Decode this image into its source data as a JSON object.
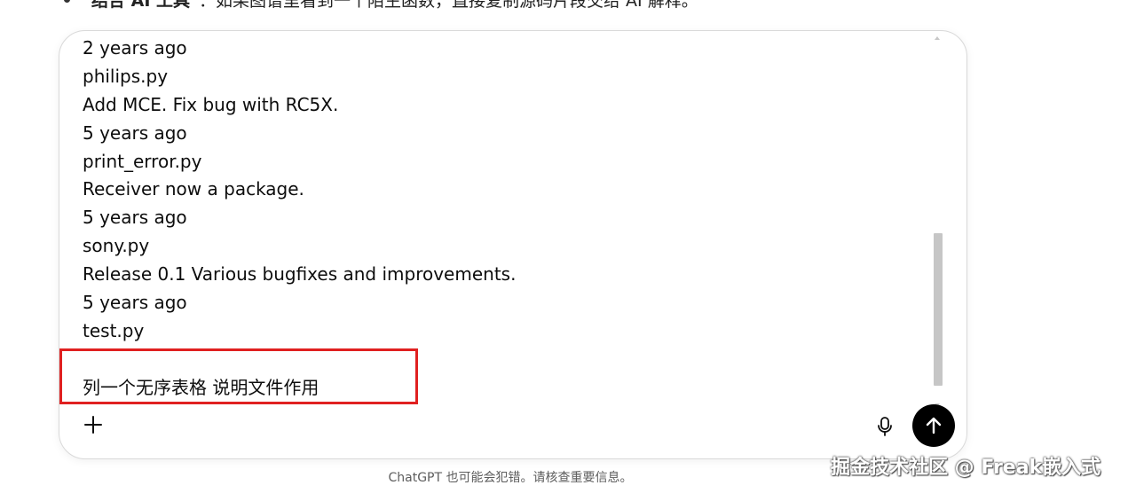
{
  "top_text": {
    "bold_part": "结合 AI 工具",
    "rest": "：如果图谱里看到一个陌生函数，直接复制源码片段交给 AI 解释。"
  },
  "composer": {
    "lines": [
      "2 years ago",
      "philips.py",
      "Add MCE. Fix bug with RC5X.",
      "5 years ago",
      "print_error.py",
      "Receiver now a package.",
      "5 years ago",
      "sony.py",
      "Release 0.1 Various bugfixes and improvements.",
      "5 years ago",
      "test.py",
      "",
      "列一个无序表格 说明文件作用"
    ]
  },
  "icons": {
    "plus": "plus-icon",
    "mic": "microphone-icon",
    "send": "arrow-up-icon"
  },
  "colors": {
    "highlight": "#e02020",
    "send_button": "#000000"
  },
  "footer": {
    "disclaimer": "ChatGPT 也可能会犯错。请核查重要信息。",
    "watermark": "掘金技术社区 @ Freak嵌入式"
  }
}
